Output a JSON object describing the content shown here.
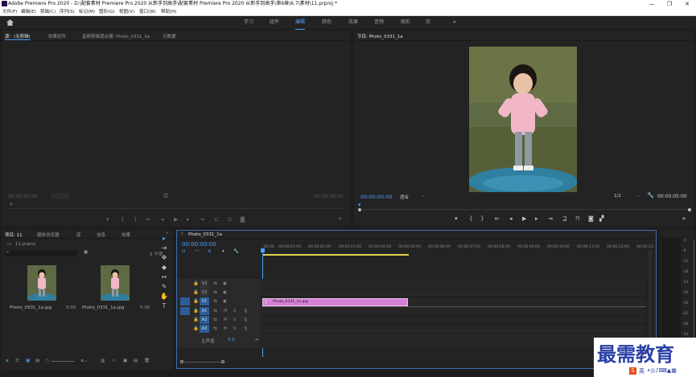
{
  "titlebar": {
    "title": "Adobe Premiere Pro 2020 - D:\\配套素材 Premiere Pro 2020 从新手到高手\\配套素材 Premiere Pro 2020 从新手到高手\\第6章\\6.7\\素材\\11.prproj *",
    "minimize": "—",
    "maximize": "❐",
    "close": "✕"
  },
  "menu": [
    "文件(F)",
    "编辑(E)",
    "剪辑(C)",
    "序列(S)",
    "标记(M)",
    "图形(G)",
    "视图(V)",
    "窗口(W)",
    "帮助(H)"
  ],
  "workspaces": {
    "home_icon": "home-icon",
    "items": [
      "学习",
      "组件",
      "编辑",
      "颜色",
      "效果",
      "音频",
      "图形",
      "库"
    ],
    "active": "编辑",
    "more": "»"
  },
  "source_panel": {
    "tabs": [
      "源：(无剪辑)",
      "效果控件",
      "音频剪辑混合器: Photo_0331_1a",
      "元数据"
    ],
    "active_tab": 0,
    "tc_left": "00;00;00;00",
    "tc_right": "00;00;00;00"
  },
  "program_panel": {
    "tab": "节目: Photo_0331_1a",
    "timecode": "00:00:00:00",
    "fit": "适合",
    "ratio": "1/2",
    "duration": "00:00:05:00",
    "overflow": "»"
  },
  "project_panel": {
    "tabs": [
      "项目: 11",
      "媒体浏览器",
      "库",
      "信息",
      "效果"
    ],
    "more": "»",
    "filename": "11.prproj",
    "count": "2 个项",
    "items": [
      {
        "name": "Photo_0331_1a.jpg",
        "duration": "5:00"
      },
      {
        "name": "Photo_0331_1a.jpg",
        "duration": "5:00"
      }
    ]
  },
  "timeline": {
    "tab": "Photo_0331_1a",
    "close": "×",
    "timecode": "00:00:00:00",
    "ruler": [
      ":00:00",
      "00:00:01:00",
      "00:00:02:00",
      "00:00:03:00",
      "00:00:04:00",
      "00:00:05:00",
      "00:00:06:00",
      "00:00:07:00",
      "00:00:08:00",
      "00:00:09:00",
      "00:00:10:00",
      "00:00:11:00",
      "00:00:12:00",
      "00:00:13:"
    ],
    "video_tracks": [
      "V3",
      "V2",
      "V1"
    ],
    "audio_tracks": [
      "A1",
      "A2",
      "A3"
    ],
    "master_label": "主声道",
    "master_value": "0.0",
    "clip": {
      "name": "Photo_0331_1a.jpg",
      "color": "#d67fd6"
    },
    "track_buttons": {
      "mute": "M",
      "solo": "S"
    }
  },
  "meters": {
    "labels": [
      "0",
      "-6",
      "-12",
      "-18",
      "-24",
      "-30",
      "-36",
      "-42",
      "-48",
      "-54",
      "dB"
    ],
    "solo": [
      "S",
      "S"
    ]
  },
  "watermark": {
    "text": "最需教育",
    "ime": "英"
  },
  "colors": {
    "accent": "#4aa0ff",
    "timecode": "#4aa0ff",
    "clip": "#d67fd6",
    "workarea": "#e0d44a"
  }
}
